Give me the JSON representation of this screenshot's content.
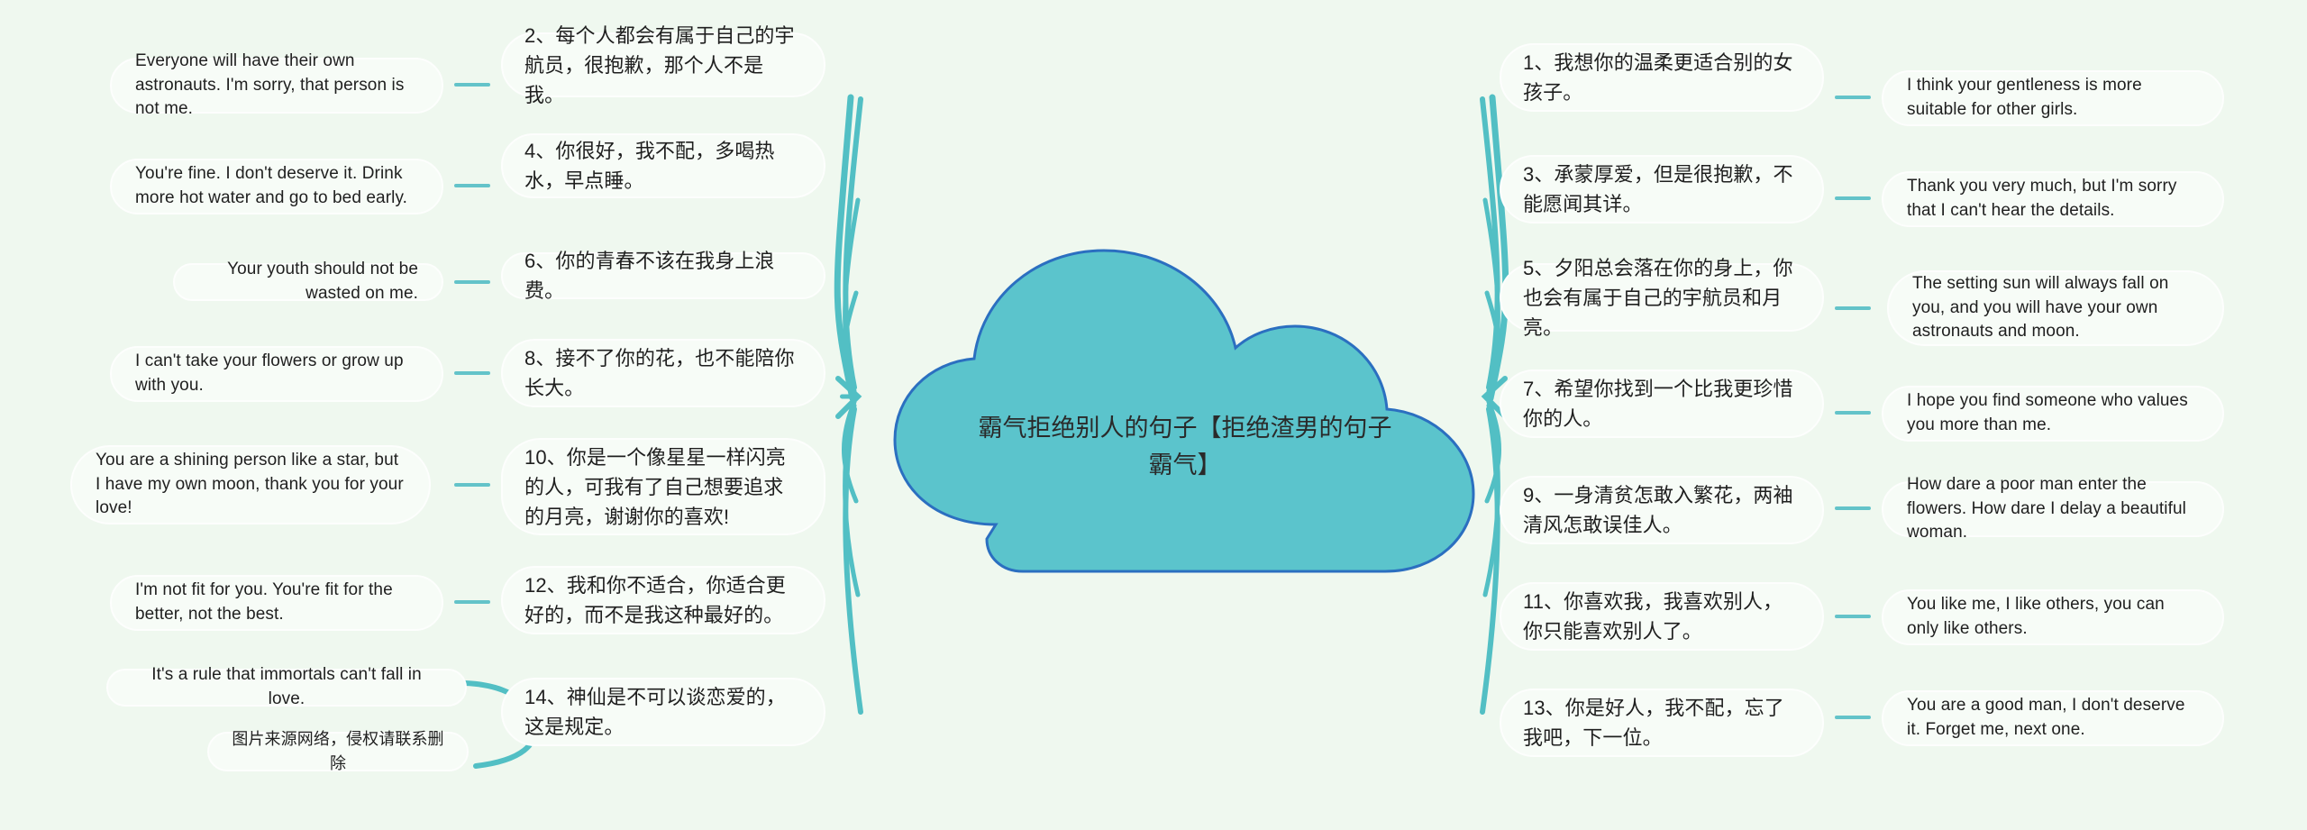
{
  "theme": {
    "background": "#eff8ef",
    "cloud_fill": "#5bc4cc",
    "cloud_stroke": "#2b6fc0",
    "branch_color": "#52bfc4",
    "node_fill": "#f7fcf7",
    "node_border": "#fdfefd",
    "text_color": "#1f1f1f"
  },
  "center": {
    "title": "霸气拒绝别人的句子【拒绝渣男的句子霸气】"
  },
  "left_branch": {
    "items": [
      {
        "zh": "2、每个人都会有属于自己的宇航员，很抱歉，那个人不是我。",
        "en": "Everyone will have their own astronauts. I'm sorry, that person is not me."
      },
      {
        "zh": "4、你很好，我不配，多喝热水，早点睡。",
        "en": "You're fine. I don't deserve it. Drink more hot water and go to bed early."
      },
      {
        "zh": "6、你的青春不该在我身上浪费。",
        "en": "Your youth should not be wasted on me."
      },
      {
        "zh": "8、接不了你的花，也不能陪你长大。",
        "en": "I can't take your flowers or grow up with you."
      },
      {
        "zh": "10、你是一个像星星一样闪亮的人，可我有了自己想要追求的月亮，谢谢你的喜欢!",
        "en": "You are a shining person like a star, but I have my own moon, thank you for your love!"
      },
      {
        "zh": "12、我和你不适合，你适合更好的，而不是我这种最好的。",
        "en": "I'm not fit for you. You're fit for the better, not the best."
      },
      {
        "zh": "14、神仙是不可以谈恋爱的，这是规定。",
        "en": "It's a rule that immortals can't fall in love."
      }
    ],
    "watermark": "图片来源网络，侵权请联系删除"
  },
  "right_branch": {
    "items": [
      {
        "zh": "1、我想你的温柔更适合别的女孩子。",
        "en": "I think your gentleness is more suitable for other girls."
      },
      {
        "zh": "3、承蒙厚爱，但是很抱歉，不能愿闻其详。",
        "en": "Thank you very much, but I'm sorry that I can't hear the details."
      },
      {
        "zh": "5、夕阳总会落在你的身上，你也会有属于自己的宇航员和月亮。",
        "en": "The setting sun will always fall on you, and you will have your own astronauts and moon."
      },
      {
        "zh": "7、希望你找到一个比我更珍惜你的人。",
        "en": "I hope you find someone who values you more than me."
      },
      {
        "zh": "9、一身清贫怎敢入繁花，两袖清风怎敢误佳人。",
        "en": "How dare a poor man enter the flowers. How dare I delay a beautiful woman."
      },
      {
        "zh": "11、你喜欢我，我喜欢别人，你只能喜欢别人了。",
        "en": "You like me, I like others, you can only like others."
      },
      {
        "zh": "13、你是好人，我不配，忘了我吧，下一位。",
        "en": "You are a good man, I don't deserve it. Forget me, next one."
      }
    ]
  }
}
